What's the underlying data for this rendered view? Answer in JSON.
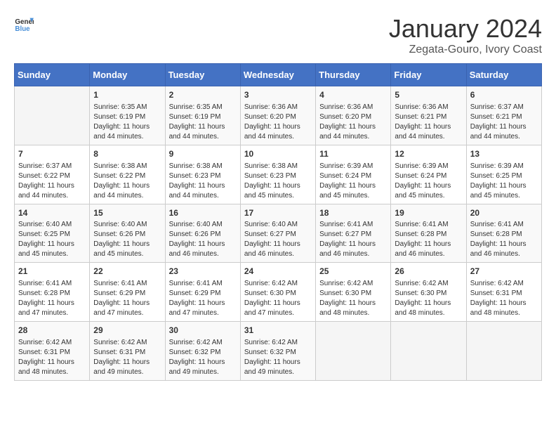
{
  "header": {
    "logo_general": "General",
    "logo_blue": "Blue",
    "month_title": "January 2024",
    "location": "Zegata-Gouro, Ivory Coast"
  },
  "weekdays": [
    "Sunday",
    "Monday",
    "Tuesday",
    "Wednesday",
    "Thursday",
    "Friday",
    "Saturday"
  ],
  "weeks": [
    [
      {
        "day": "",
        "sunrise": "",
        "sunset": "",
        "daylight": ""
      },
      {
        "day": "1",
        "sunrise": "Sunrise: 6:35 AM",
        "sunset": "Sunset: 6:19 PM",
        "daylight": "Daylight: 11 hours and 44 minutes."
      },
      {
        "day": "2",
        "sunrise": "Sunrise: 6:35 AM",
        "sunset": "Sunset: 6:19 PM",
        "daylight": "Daylight: 11 hours and 44 minutes."
      },
      {
        "day": "3",
        "sunrise": "Sunrise: 6:36 AM",
        "sunset": "Sunset: 6:20 PM",
        "daylight": "Daylight: 11 hours and 44 minutes."
      },
      {
        "day": "4",
        "sunrise": "Sunrise: 6:36 AM",
        "sunset": "Sunset: 6:20 PM",
        "daylight": "Daylight: 11 hours and 44 minutes."
      },
      {
        "day": "5",
        "sunrise": "Sunrise: 6:36 AM",
        "sunset": "Sunset: 6:21 PM",
        "daylight": "Daylight: 11 hours and 44 minutes."
      },
      {
        "day": "6",
        "sunrise": "Sunrise: 6:37 AM",
        "sunset": "Sunset: 6:21 PM",
        "daylight": "Daylight: 11 hours and 44 minutes."
      }
    ],
    [
      {
        "day": "7",
        "sunrise": "Sunrise: 6:37 AM",
        "sunset": "Sunset: 6:22 PM",
        "daylight": "Daylight: 11 hours and 44 minutes."
      },
      {
        "day": "8",
        "sunrise": "Sunrise: 6:38 AM",
        "sunset": "Sunset: 6:22 PM",
        "daylight": "Daylight: 11 hours and 44 minutes."
      },
      {
        "day": "9",
        "sunrise": "Sunrise: 6:38 AM",
        "sunset": "Sunset: 6:23 PM",
        "daylight": "Daylight: 11 hours and 44 minutes."
      },
      {
        "day": "10",
        "sunrise": "Sunrise: 6:38 AM",
        "sunset": "Sunset: 6:23 PM",
        "daylight": "Daylight: 11 hours and 45 minutes."
      },
      {
        "day": "11",
        "sunrise": "Sunrise: 6:39 AM",
        "sunset": "Sunset: 6:24 PM",
        "daylight": "Daylight: 11 hours and 45 minutes."
      },
      {
        "day": "12",
        "sunrise": "Sunrise: 6:39 AM",
        "sunset": "Sunset: 6:24 PM",
        "daylight": "Daylight: 11 hours and 45 minutes."
      },
      {
        "day": "13",
        "sunrise": "Sunrise: 6:39 AM",
        "sunset": "Sunset: 6:25 PM",
        "daylight": "Daylight: 11 hours and 45 minutes."
      }
    ],
    [
      {
        "day": "14",
        "sunrise": "Sunrise: 6:40 AM",
        "sunset": "Sunset: 6:25 PM",
        "daylight": "Daylight: 11 hours and 45 minutes."
      },
      {
        "day": "15",
        "sunrise": "Sunrise: 6:40 AM",
        "sunset": "Sunset: 6:26 PM",
        "daylight": "Daylight: 11 hours and 45 minutes."
      },
      {
        "day": "16",
        "sunrise": "Sunrise: 6:40 AM",
        "sunset": "Sunset: 6:26 PM",
        "daylight": "Daylight: 11 hours and 46 minutes."
      },
      {
        "day": "17",
        "sunrise": "Sunrise: 6:40 AM",
        "sunset": "Sunset: 6:27 PM",
        "daylight": "Daylight: 11 hours and 46 minutes."
      },
      {
        "day": "18",
        "sunrise": "Sunrise: 6:41 AM",
        "sunset": "Sunset: 6:27 PM",
        "daylight": "Daylight: 11 hours and 46 minutes."
      },
      {
        "day": "19",
        "sunrise": "Sunrise: 6:41 AM",
        "sunset": "Sunset: 6:28 PM",
        "daylight": "Daylight: 11 hours and 46 minutes."
      },
      {
        "day": "20",
        "sunrise": "Sunrise: 6:41 AM",
        "sunset": "Sunset: 6:28 PM",
        "daylight": "Daylight: 11 hours and 46 minutes."
      }
    ],
    [
      {
        "day": "21",
        "sunrise": "Sunrise: 6:41 AM",
        "sunset": "Sunset: 6:28 PM",
        "daylight": "Daylight: 11 hours and 47 minutes."
      },
      {
        "day": "22",
        "sunrise": "Sunrise: 6:41 AM",
        "sunset": "Sunset: 6:29 PM",
        "daylight": "Daylight: 11 hours and 47 minutes."
      },
      {
        "day": "23",
        "sunrise": "Sunrise: 6:41 AM",
        "sunset": "Sunset: 6:29 PM",
        "daylight": "Daylight: 11 hours and 47 minutes."
      },
      {
        "day": "24",
        "sunrise": "Sunrise: 6:42 AM",
        "sunset": "Sunset: 6:30 PM",
        "daylight": "Daylight: 11 hours and 47 minutes."
      },
      {
        "day": "25",
        "sunrise": "Sunrise: 6:42 AM",
        "sunset": "Sunset: 6:30 PM",
        "daylight": "Daylight: 11 hours and 48 minutes."
      },
      {
        "day": "26",
        "sunrise": "Sunrise: 6:42 AM",
        "sunset": "Sunset: 6:30 PM",
        "daylight": "Daylight: 11 hours and 48 minutes."
      },
      {
        "day": "27",
        "sunrise": "Sunrise: 6:42 AM",
        "sunset": "Sunset: 6:31 PM",
        "daylight": "Daylight: 11 hours and 48 minutes."
      }
    ],
    [
      {
        "day": "28",
        "sunrise": "Sunrise: 6:42 AM",
        "sunset": "Sunset: 6:31 PM",
        "daylight": "Daylight: 11 hours and 48 minutes."
      },
      {
        "day": "29",
        "sunrise": "Sunrise: 6:42 AM",
        "sunset": "Sunset: 6:31 PM",
        "daylight": "Daylight: 11 hours and 49 minutes."
      },
      {
        "day": "30",
        "sunrise": "Sunrise: 6:42 AM",
        "sunset": "Sunset: 6:32 PM",
        "daylight": "Daylight: 11 hours and 49 minutes."
      },
      {
        "day": "31",
        "sunrise": "Sunrise: 6:42 AM",
        "sunset": "Sunset: 6:32 PM",
        "daylight": "Daylight: 11 hours and 49 minutes."
      },
      {
        "day": "",
        "sunrise": "",
        "sunset": "",
        "daylight": ""
      },
      {
        "day": "",
        "sunrise": "",
        "sunset": "",
        "daylight": ""
      },
      {
        "day": "",
        "sunrise": "",
        "sunset": "",
        "daylight": ""
      }
    ]
  ]
}
